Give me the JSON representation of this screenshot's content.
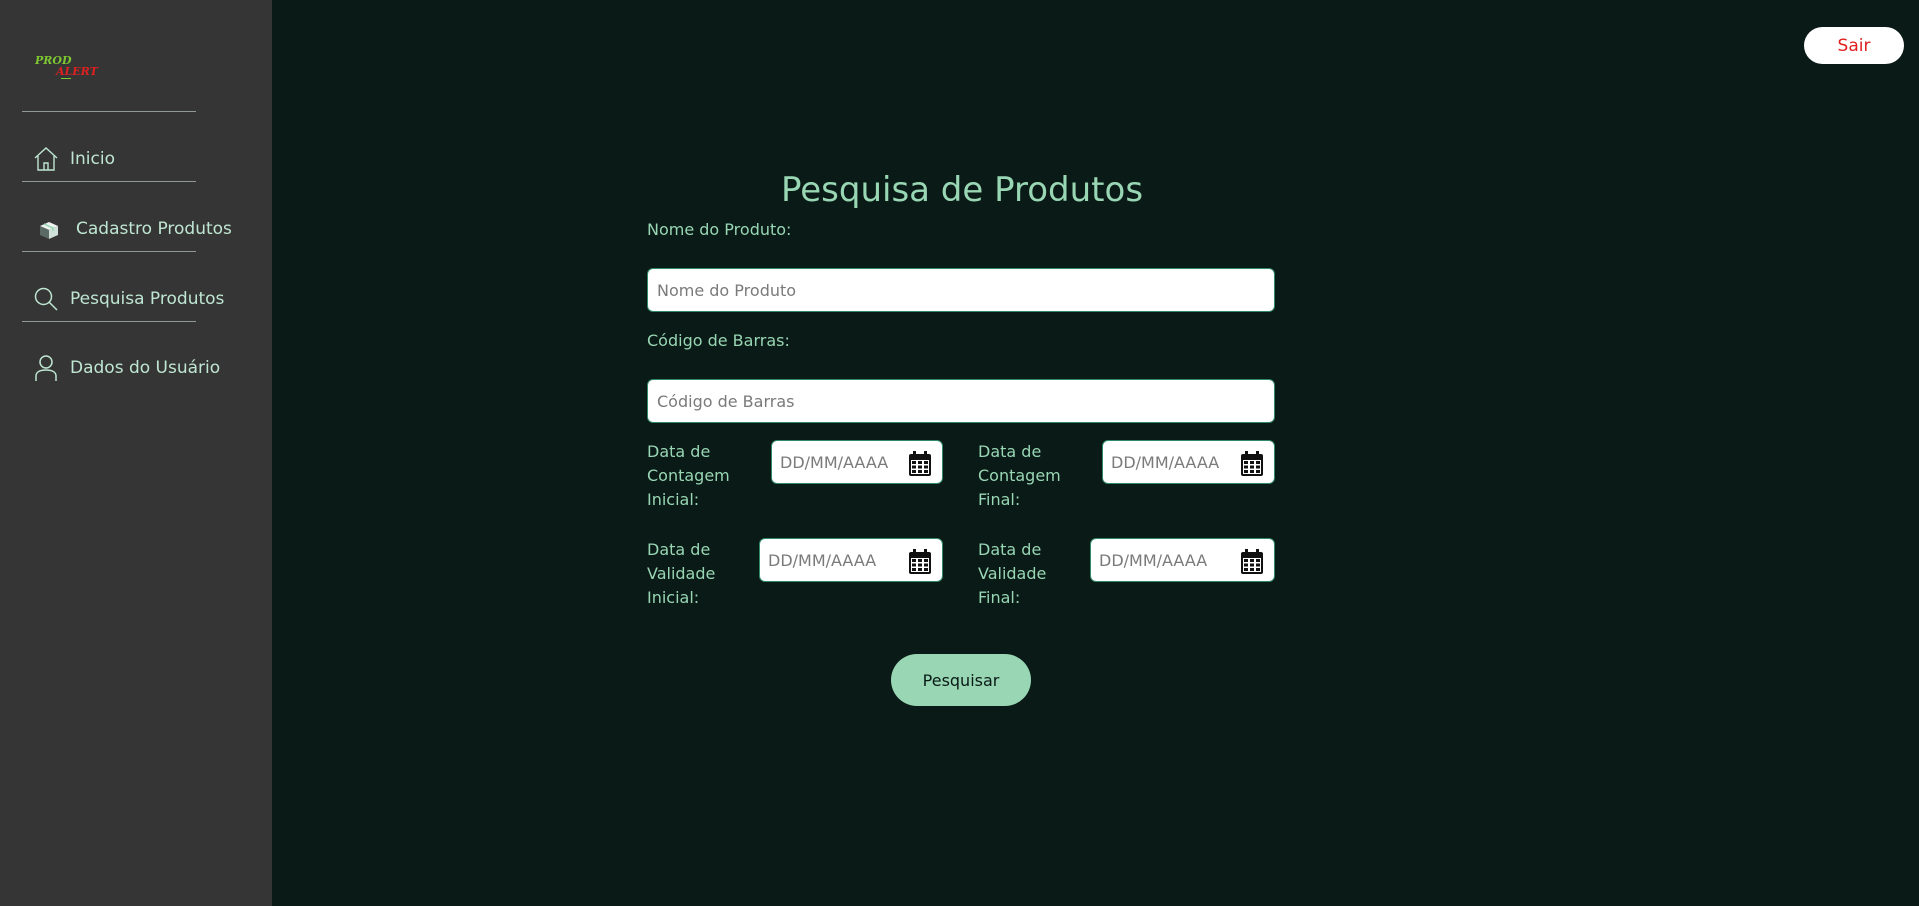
{
  "brand": {
    "logo_text_top": "PROD",
    "logo_text_bottom": "ALERT",
    "logo_top_color": "#7ec832",
    "logo_bottom_color": "#e02020"
  },
  "sidebar": {
    "items": [
      {
        "label": "Inicio",
        "icon": "home-icon"
      },
      {
        "label": "Cadastro Produtos",
        "icon": "box-icon"
      },
      {
        "label": "Pesquisa Produtos",
        "icon": "search-icon"
      },
      {
        "label": "Dados do Usuário",
        "icon": "user-icon"
      }
    ]
  },
  "header": {
    "logout_label": "Sair"
  },
  "form": {
    "title": "Pesquisa de Produtos",
    "product_name": {
      "label": "Nome do Produto:",
      "placeholder": "Nome do Produto",
      "value": ""
    },
    "barcode": {
      "label": "Código de Barras:",
      "placeholder": "Código de Barras",
      "value": ""
    },
    "count_start": {
      "label_lines": [
        "Data de",
        "Contagem",
        "Inicial:"
      ],
      "placeholder": "DD/MM/AAAA"
    },
    "count_end": {
      "label_lines": [
        "Data de",
        "Contagem",
        "Final:"
      ],
      "placeholder": "DD/MM/AAAA"
    },
    "validity_start": {
      "label_lines": [
        "Data de",
        "Validade",
        "Inicial:"
      ],
      "placeholder": "DD/MM/AAAA"
    },
    "validity_end": {
      "label_lines": [
        "Data de",
        "Validade",
        "Final:"
      ],
      "placeholder": "DD/MM/AAAA"
    },
    "submit_label": "Pesquisar"
  },
  "colors": {
    "sidebar_bg": "#353535",
    "page_bg": "#0a1a16",
    "accent": "#98d6b4",
    "logout_text": "#e02020"
  }
}
